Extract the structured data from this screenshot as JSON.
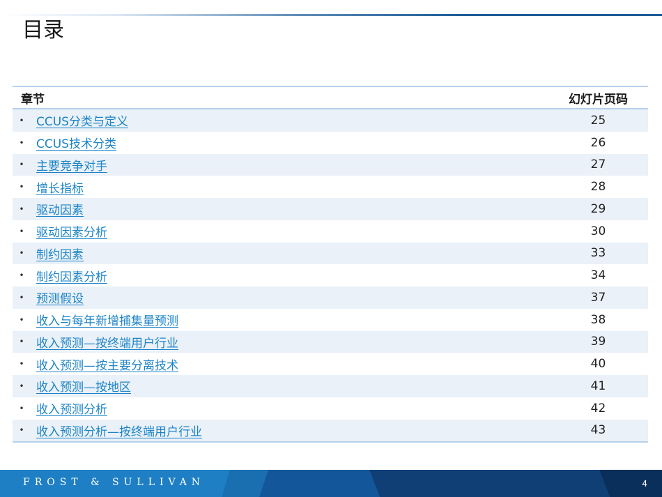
{
  "slide": {
    "title": "目录",
    "page_number": "4"
  },
  "table": {
    "header_chapter": "章节",
    "header_page": "幻灯片页码",
    "rows": [
      {
        "label": "CCUS分类与定义",
        "page": "25"
      },
      {
        "label": "CCUS技术分类",
        "page": "26"
      },
      {
        "label": "主要竞争对手",
        "page": "27"
      },
      {
        "label": "增长指标",
        "page": "28"
      },
      {
        "label": "驱动因素",
        "page": "29"
      },
      {
        "label": "驱动因素分析",
        "page": "30"
      },
      {
        "label": "制约因素",
        "page": "33"
      },
      {
        "label": "制约因素分析",
        "page": "34"
      },
      {
        "label": "预测假设",
        "page": "37"
      },
      {
        "label": "收入与每年新增捕集量预测",
        "page": "38"
      },
      {
        "label": "收入预测—按终端用户行业",
        "page": "39"
      },
      {
        "label": "收入预测—按主要分离技术",
        "page": "40"
      },
      {
        "label": "收入预测—按地区",
        "page": "41"
      },
      {
        "label": "收入预测分析",
        "page": "42"
      },
      {
        "label": "收入预测分析—按终端用户行业",
        "page": "43"
      }
    ]
  },
  "footer": {
    "brand": "FROST & SULLIVAN"
  },
  "colors": {
    "link": "#1c84c6",
    "row_alt": "#eaf1f8",
    "rule": "#b7d1ea",
    "footer_light": "#1e7fc4",
    "footer_dark": "#0f3f72"
  }
}
